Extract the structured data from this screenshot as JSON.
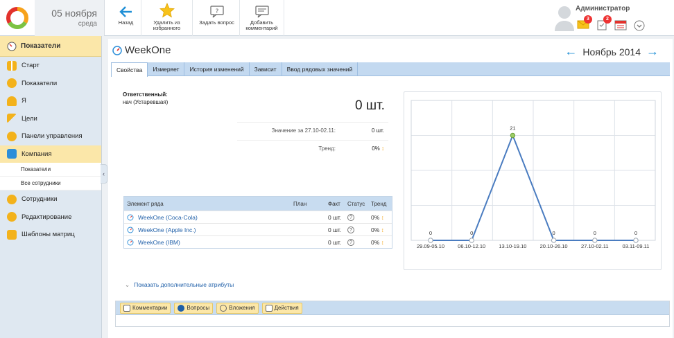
{
  "header": {
    "date_day": "05 ноября",
    "date_weekday": "среда",
    "buttons": [
      {
        "label": "Назад",
        "icon": "arrow-left-icon"
      },
      {
        "label": "Удалить из избранного",
        "icon": "star-icon"
      },
      {
        "label": "Задать вопрос",
        "icon": "question-bubble-icon"
      },
      {
        "label": "Добавить комментарий",
        "icon": "comment-icon"
      }
    ],
    "user_name": "Администратор",
    "badge_messages": "3",
    "badge_tasks": "2"
  },
  "sidebar": {
    "header": "Показатели",
    "items": [
      {
        "label": "Старт",
        "icon": "grid-icon"
      },
      {
        "label": "Показатели",
        "icon": "gauge-icon"
      },
      {
        "label": "Я",
        "icon": "person-icon"
      },
      {
        "label": "Цели",
        "icon": "flag-icon"
      },
      {
        "label": "Панели управления",
        "icon": "dashboard-icon"
      },
      {
        "label": "Компания",
        "icon": "factory-icon"
      }
    ],
    "subitems": [
      "Показатели",
      "Все сотрудники"
    ],
    "items_after": [
      {
        "label": "Сотрудники",
        "icon": "people-icon"
      },
      {
        "label": "Редактирование",
        "icon": "edit-icon"
      },
      {
        "label": "Шаблоны матриц",
        "icon": "template-icon"
      }
    ]
  },
  "page": {
    "title": "WeekOne",
    "period": "Ноябрь 2014",
    "tabs": [
      "Свойства",
      "Измеряет",
      "История изменений",
      "Зависит",
      "Ввод рядовых значений"
    ],
    "responsible_label": "Ответственный:",
    "responsible_value": "нач (Устаревшая)",
    "big_value": "0 шт.",
    "value_label": "Значение за 27.10-02.11:",
    "value_value": "0 шт.",
    "trend_label": "Тренд:",
    "trend_value": "0%",
    "show_more": "Показать дополнительные атрибуты"
  },
  "table": {
    "headers": [
      "Элемент ряда",
      "План",
      "Факт",
      "Статус",
      "Тренд"
    ],
    "rows": [
      {
        "name": "WeekOne (Coca-Cola)",
        "plan": "",
        "fact": "0 шт.",
        "status": "?",
        "trend": "0%"
      },
      {
        "name": "WeekOne (Apple Inc.)",
        "plan": "",
        "fact": "0 шт.",
        "status": "?",
        "trend": "0%"
      },
      {
        "name": "WeekOne (IBM)",
        "plan": "",
        "fact": "0 шт.",
        "status": "?",
        "trend": "0%"
      }
    ]
  },
  "chart_data": {
    "type": "line",
    "categories": [
      "29.09-05.10",
      "06.10-12.10",
      "13.10-19.10",
      "20.10-26.10",
      "27.10-02.11",
      "03.11-09.11"
    ],
    "values": [
      0,
      0,
      21,
      0,
      0,
      0
    ],
    "ylim": [
      0,
      28
    ],
    "grid": true,
    "line_color": "#4a7cc0",
    "highlight_color": "#9ccc65"
  },
  "bottom_buttons": [
    {
      "label": "Комментарии",
      "icon": "comment-icon"
    },
    {
      "label": "Вопросы",
      "icon": "question-icon"
    },
    {
      "label": "Вложения",
      "icon": "paperclip-icon"
    },
    {
      "label": "Действия",
      "icon": "actions-icon"
    }
  ]
}
